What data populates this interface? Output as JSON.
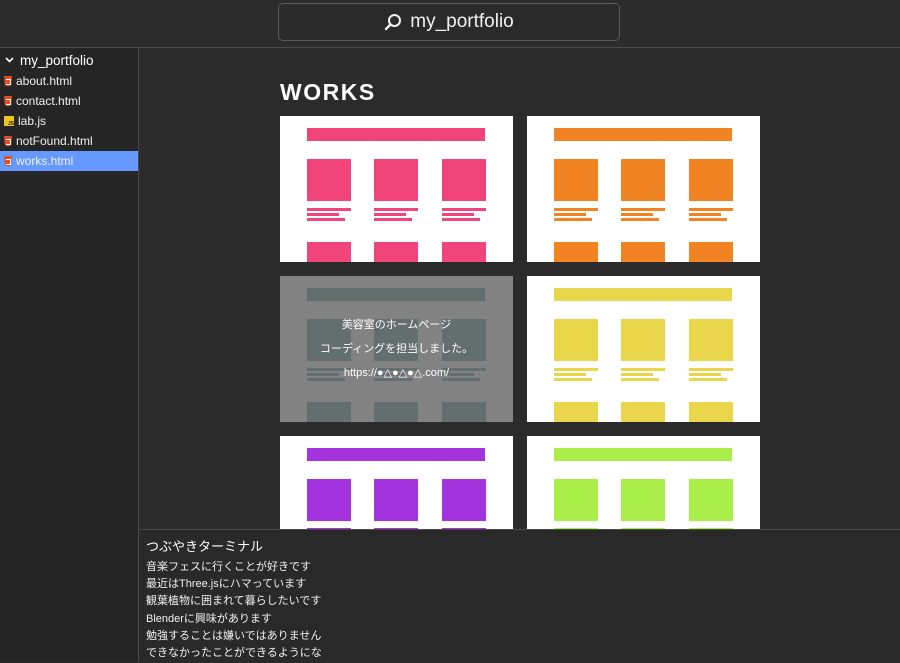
{
  "search": {
    "text": "my_portfolio",
    "icon": "search-icon"
  },
  "sidebar": {
    "folder": "my_portfolio",
    "items": [
      {
        "label": "about.html",
        "type": "html",
        "selected": false
      },
      {
        "label": "contact.html",
        "type": "html",
        "selected": false
      },
      {
        "label": "lab.js",
        "type": "js",
        "selected": false
      },
      {
        "label": "notFound.html",
        "type": "html",
        "selected": false
      },
      {
        "label": "works.html",
        "type": "html",
        "selected": true
      }
    ]
  },
  "main": {
    "title": "WORKS",
    "cards": [
      {
        "color": "#f0447a",
        "hovered": false
      },
      {
        "color": "#f28322",
        "hovered": false
      },
      {
        "color": "#237079",
        "hovered": true,
        "overlay": [
          "美容室のホームページ",
          "コーディングを担当しました。",
          "https://●△●△●△.com/"
        ]
      },
      {
        "color": "#ead64a",
        "hovered": false
      },
      {
        "color": "#a334dd",
        "hovered": false
      },
      {
        "color": "#aaee4a",
        "hovered": false
      }
    ]
  },
  "terminal": {
    "title": "つぶやきターミナル",
    "lines": [
      "音楽フェスに行くことが好きです",
      "最近はThree.jsにハマっています",
      "観葉植物に囲まれて暮らしたいです",
      "Blenderに興味があります",
      "勉強することは嫌いではありません",
      "できなかったことができるようにな"
    ]
  },
  "colors": {
    "selected": "#6699ff",
    "background": "#2b2b2b"
  }
}
